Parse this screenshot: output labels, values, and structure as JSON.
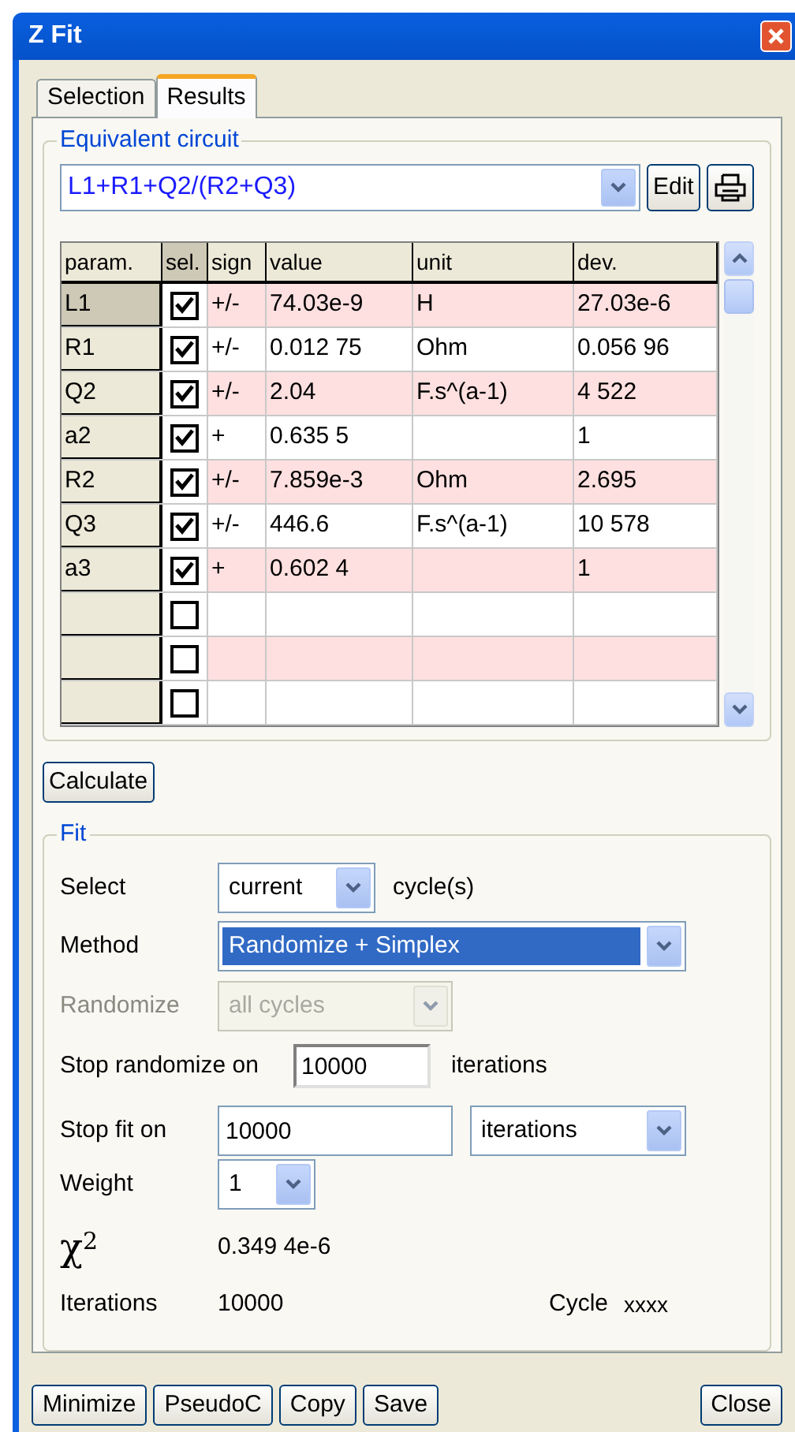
{
  "window": {
    "title": "Z Fit"
  },
  "tabs": [
    {
      "label": "Selection",
      "selected": false
    },
    {
      "label": "Results",
      "selected": true
    }
  ],
  "equivalent_circuit": {
    "legend": "Equivalent circuit",
    "circuit": "L1+R1+Q2/(R2+Q3)",
    "edit_button": "Edit",
    "table": {
      "columns": [
        "param.",
        "sel.",
        "sign",
        "value",
        "unit",
        "dev."
      ],
      "rows": [
        {
          "param": "L1",
          "checked": true,
          "sign": "+/-",
          "value": "74.03e-9",
          "unit": "H",
          "dev": "27.03e-6",
          "selected": true
        },
        {
          "param": "R1",
          "checked": true,
          "sign": "+/-",
          "value": "0.012 75",
          "unit": "Ohm",
          "dev": "0.056 96",
          "selected": false
        },
        {
          "param": "Q2",
          "checked": true,
          "sign": "+/-",
          "value": "2.04",
          "unit": "F.s^(a-1)",
          "dev": "4 522",
          "selected": false
        },
        {
          "param": "a2",
          "checked": true,
          "sign": "+",
          "value": "0.635 5",
          "unit": "",
          "dev": "1",
          "selected": false
        },
        {
          "param": "R2",
          "checked": true,
          "sign": "+/-",
          "value": "7.859e-3",
          "unit": "Ohm",
          "dev": "2.695",
          "selected": false
        },
        {
          "param": "Q3",
          "checked": true,
          "sign": "+/-",
          "value": "446.6",
          "unit": "F.s^(a-1)",
          "dev": "10 578",
          "selected": false
        },
        {
          "param": "a3",
          "checked": true,
          "sign": "+",
          "value": "0.602 4",
          "unit": "",
          "dev": "1",
          "selected": false
        },
        {
          "param": "",
          "checked": false,
          "sign": "",
          "value": "",
          "unit": "",
          "dev": "",
          "selected": false
        },
        {
          "param": "",
          "checked": false,
          "sign": "",
          "value": "",
          "unit": "",
          "dev": "",
          "selected": false
        },
        {
          "param": "",
          "checked": false,
          "sign": "",
          "value": "",
          "unit": "",
          "dev": "",
          "selected": false
        }
      ]
    }
  },
  "calculate_button": "Calculate",
  "fit": {
    "legend": "Fit",
    "select": {
      "label": "Select",
      "value": "current",
      "suffix": "cycle(s)"
    },
    "method": {
      "label": "Method",
      "value": "Randomize + Simplex",
      "highlighted": true
    },
    "randomize": {
      "label": "Randomize",
      "value": "all cycles",
      "disabled": true
    },
    "stop_randomize": {
      "label": "Stop randomize on",
      "value": "10000",
      "suffix": "iterations"
    },
    "stop_fit": {
      "label": "Stop fit on",
      "value": "10000",
      "unit": "iterations"
    },
    "weight": {
      "label": "Weight",
      "value": "1"
    },
    "chi2": {
      "label": "χ$^{2}$",
      "value": "0.349 4e-6"
    },
    "iterations": {
      "label": "Iterations",
      "value": "10000"
    },
    "cycle": {
      "label": "Cycle",
      "value": "xxxx"
    }
  },
  "buttons": [
    {
      "label": "Minimize"
    },
    {
      "label": "PseudoC"
    },
    {
      "label": "Copy"
    },
    {
      "label": "Save"
    },
    {
      "label": "Close"
    }
  ]
}
